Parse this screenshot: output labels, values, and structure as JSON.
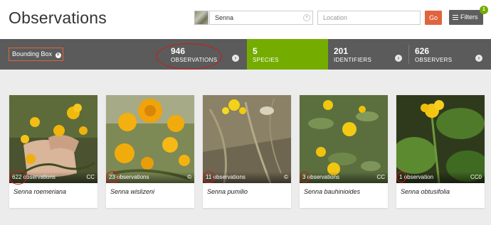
{
  "header": {
    "title": "Observations",
    "taxon_value": "Senna",
    "location_placeholder": "Location",
    "go_label": "Go",
    "filters_label": "Filters",
    "filters_badge": "1"
  },
  "statsbar": {
    "bounding_box_label": "Bounding Box",
    "stats": [
      {
        "count": "946",
        "label": "OBSERVATIONS"
      },
      {
        "count": "5",
        "label": "SPECIES"
      },
      {
        "count": "201",
        "label": "IDENTIFIERS"
      },
      {
        "count": "626",
        "label": "OBSERVERS"
      }
    ]
  },
  "colors": {
    "accent_orange": "#e0643e",
    "species_green": "#74ac00",
    "statsbar_gray": "#5b5b5b",
    "annotation_red": "#d01a1a"
  },
  "grid": {
    "cards": [
      {
        "count_text": "622 observations",
        "license": "CC",
        "name": "Senna roemeriana"
      },
      {
        "count_text": "23 observations",
        "license": "©",
        "name": "Senna wislizeni"
      },
      {
        "count_text": "11 observations",
        "license": "©",
        "name": "Senna pumilio"
      },
      {
        "count_text": "3 observations",
        "license": "CC",
        "name": "Senna bauhinioides"
      },
      {
        "count_text": "1 observation",
        "license": "CC0",
        "name": "Senna obtusifolia"
      }
    ]
  },
  "icons": {
    "clear": "×",
    "bbox_remove": "×",
    "arrow": "›"
  }
}
